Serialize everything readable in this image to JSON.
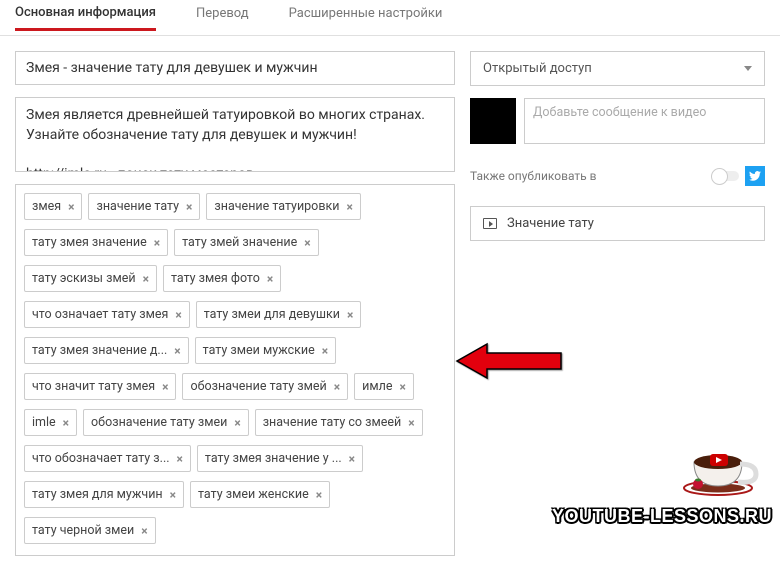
{
  "tabs": {
    "basic": "Основная информация",
    "translate": "Перевод",
    "advanced": "Расширенные настройки"
  },
  "title_value": "Змея - значение тату для девушек и мужчин",
  "description": "Змея является древнейшей татуировкой во многих странах. Узнайте обозначение тату для девушек и мужчин!\n\nhttp://imle.ru - поиск тату мастеров",
  "tags": [
    "змея",
    "значение тату",
    "значение татуировки",
    "тату змея значение",
    "тату змей значение",
    "тату эскизы змей",
    "тату змея фото",
    "что означает тату змея",
    "тату змеи для девушки",
    "тату змея значение д...",
    "тату змеи мужские",
    "что значит тату змея",
    "обозначение тату змей",
    "имле",
    "imle",
    "обозначение тату змеи",
    "значение тату со змеей",
    "что обозначает тату з...",
    "тату змея значение у ...",
    "тату змея для мужчин",
    "тату змеи женские",
    "тату черной змеи"
  ],
  "privacy": {
    "label": "Открытый доступ"
  },
  "message_placeholder": "Добавьте сообщение к видео",
  "share_label": "Также опубликовать в",
  "card_label": "Значение тату",
  "watermark": "YOUTUBE-LESSONS.RU"
}
